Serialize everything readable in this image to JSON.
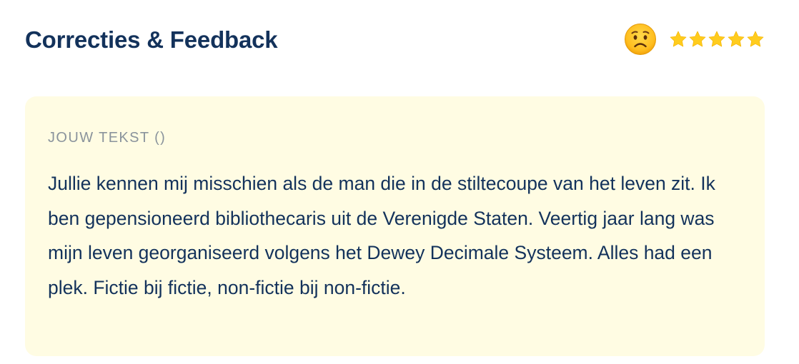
{
  "header": {
    "title": "Correcties & Feedback",
    "rating": {
      "emoji": "worried-face-icon",
      "stars_filled": 5,
      "stars_total": 5,
      "star_color": "#FFCC1E"
    }
  },
  "card": {
    "label": "JOUW TEKST ()",
    "text": "Jullie kennen mij misschien als de man die in de stiltecoupe van het leven zit. Ik ben gepensioneerd bibliothecaris uit de Verenigde Staten. Veertig jaar lang was mijn leven georganiseerd volgens het Dewey Decimale Systeem. Alles had een plek. Fictie bij fictie, non-fictie bij non-fictie.",
    "background": "#FFFCE3"
  },
  "colors": {
    "title": "#13325B",
    "label": "#8A939C",
    "body_text": "#13325B"
  }
}
